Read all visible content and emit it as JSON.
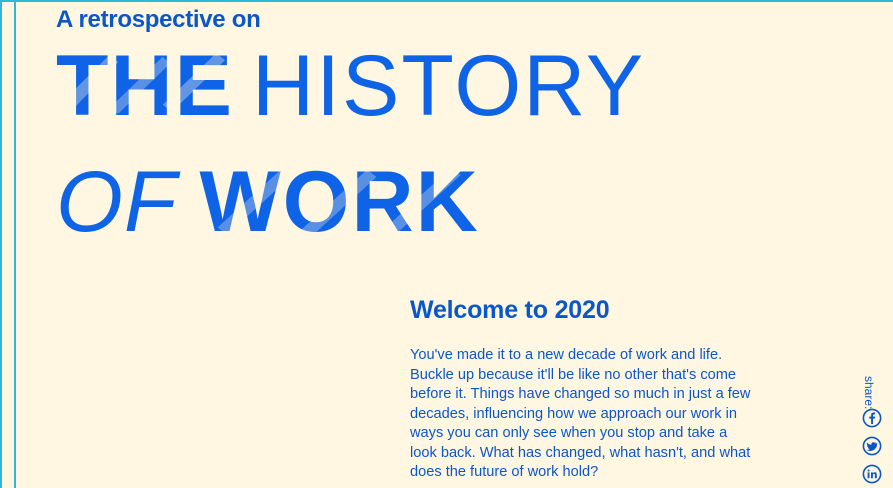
{
  "header": {
    "subtitle": "A retrospective on",
    "title_line1": [
      "THE",
      "HISTORY"
    ],
    "title_line2": [
      "OF",
      "WORK"
    ]
  },
  "intro": {
    "heading": "Welcome to 2020",
    "paragraph": "You've made it to a new decade of work and life. Buckle up because it'll be like no other that's come before it. Things have changed so much in just a few decades, influencing how we approach our work in ways you can only see when you stop and take a look back. What has changed, what hasn't, and what does the future of work hold?"
  },
  "share": {
    "label": "share:",
    "icons": [
      "facebook-icon",
      "twitter-icon",
      "linkedin-icon"
    ]
  },
  "colors": {
    "background": "#fff7e1",
    "primary": "#0b57c9",
    "accent": "#0f63e6",
    "frame": "#2fb7d9"
  }
}
